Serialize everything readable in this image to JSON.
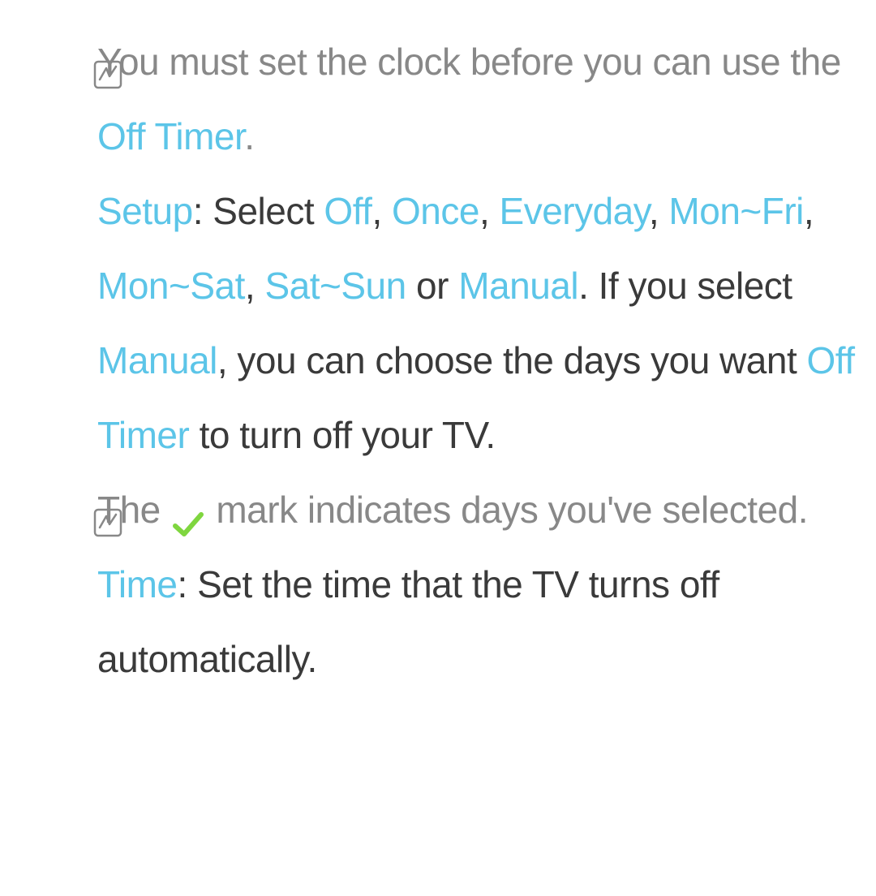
{
  "note1": {
    "part1": "You must set the clock before you can use the ",
    "hl1": "Off Timer",
    "part2": "."
  },
  "setup": {
    "label": "Setup",
    "sep1": ": Select ",
    "opt1": "Off",
    "comma1": ", ",
    "opt2": "Once",
    "comma2": ", ",
    "opt3": "Everyday",
    "comma3": ", ",
    "opt4": "Mon~Fri",
    "comma4": ", ",
    "opt5": "Mon~Sat",
    "comma5": ", ",
    "opt6": "Sat~Sun",
    "or": " or ",
    "opt7": "Manual",
    "period1": ". If you select ",
    "opt8": "Manual",
    "part2": ", you can choose the days you want ",
    "hl2": "Off Timer",
    "part3": " to turn off your TV."
  },
  "note2": {
    "part1": "The ",
    "part2": " mark indicates days you've selected."
  },
  "time": {
    "label": "Time",
    "text": ": Set the time that the TV turns off automatically."
  }
}
